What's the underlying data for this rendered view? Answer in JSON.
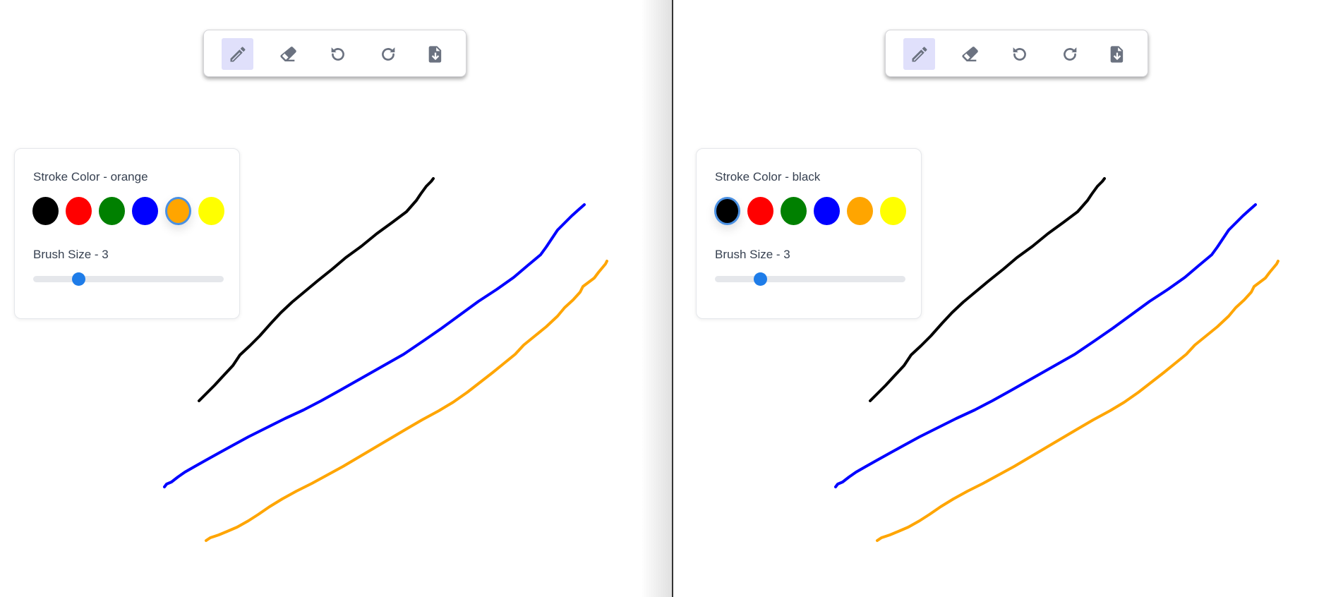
{
  "panes": [
    {
      "id": "left",
      "toolbar": {
        "tools": [
          {
            "name": "pencil-icon",
            "active": true
          },
          {
            "name": "eraser-icon",
            "active": false
          },
          {
            "name": "undo-icon",
            "active": false
          },
          {
            "name": "redo-icon",
            "active": false
          },
          {
            "name": "download-file-icon",
            "active": false
          }
        ]
      },
      "settings": {
        "stroke_color_label": "Stroke Color - orange",
        "selected_color": "orange",
        "brush_size_label": "Brush Size - 3",
        "brush_size_fraction": 0.24
      }
    },
    {
      "id": "right",
      "toolbar": {
        "tools": [
          {
            "name": "pencil-icon",
            "active": true
          },
          {
            "name": "eraser-icon",
            "active": false
          },
          {
            "name": "undo-icon",
            "active": false
          },
          {
            "name": "redo-icon",
            "active": false
          },
          {
            "name": "download-file-icon",
            "active": false
          }
        ]
      },
      "settings": {
        "stroke_color_label": "Stroke Color - black",
        "selected_color": "black",
        "brush_size_label": "Brush Size - 3",
        "brush_size_fraction": 0.24
      }
    }
  ],
  "palette": [
    {
      "name": "black",
      "hex": "#000000"
    },
    {
      "name": "red",
      "hex": "#ff0000"
    },
    {
      "name": "green",
      "hex": "#008000"
    },
    {
      "name": "blue",
      "hex": "#0000ff"
    },
    {
      "name": "orange",
      "hex": "#ffa500"
    },
    {
      "name": "yellow",
      "hex": "#ffff00"
    }
  ],
  "strokes": [
    {
      "color": "black"
    },
    {
      "color": "blue"
    },
    {
      "color": "orange"
    }
  ],
  "colors": {
    "accent": "#1e7ce8",
    "active_tool_bg": "#e0e0fb",
    "icon": "#6b7280",
    "selected_ring": "#4a90e2"
  }
}
